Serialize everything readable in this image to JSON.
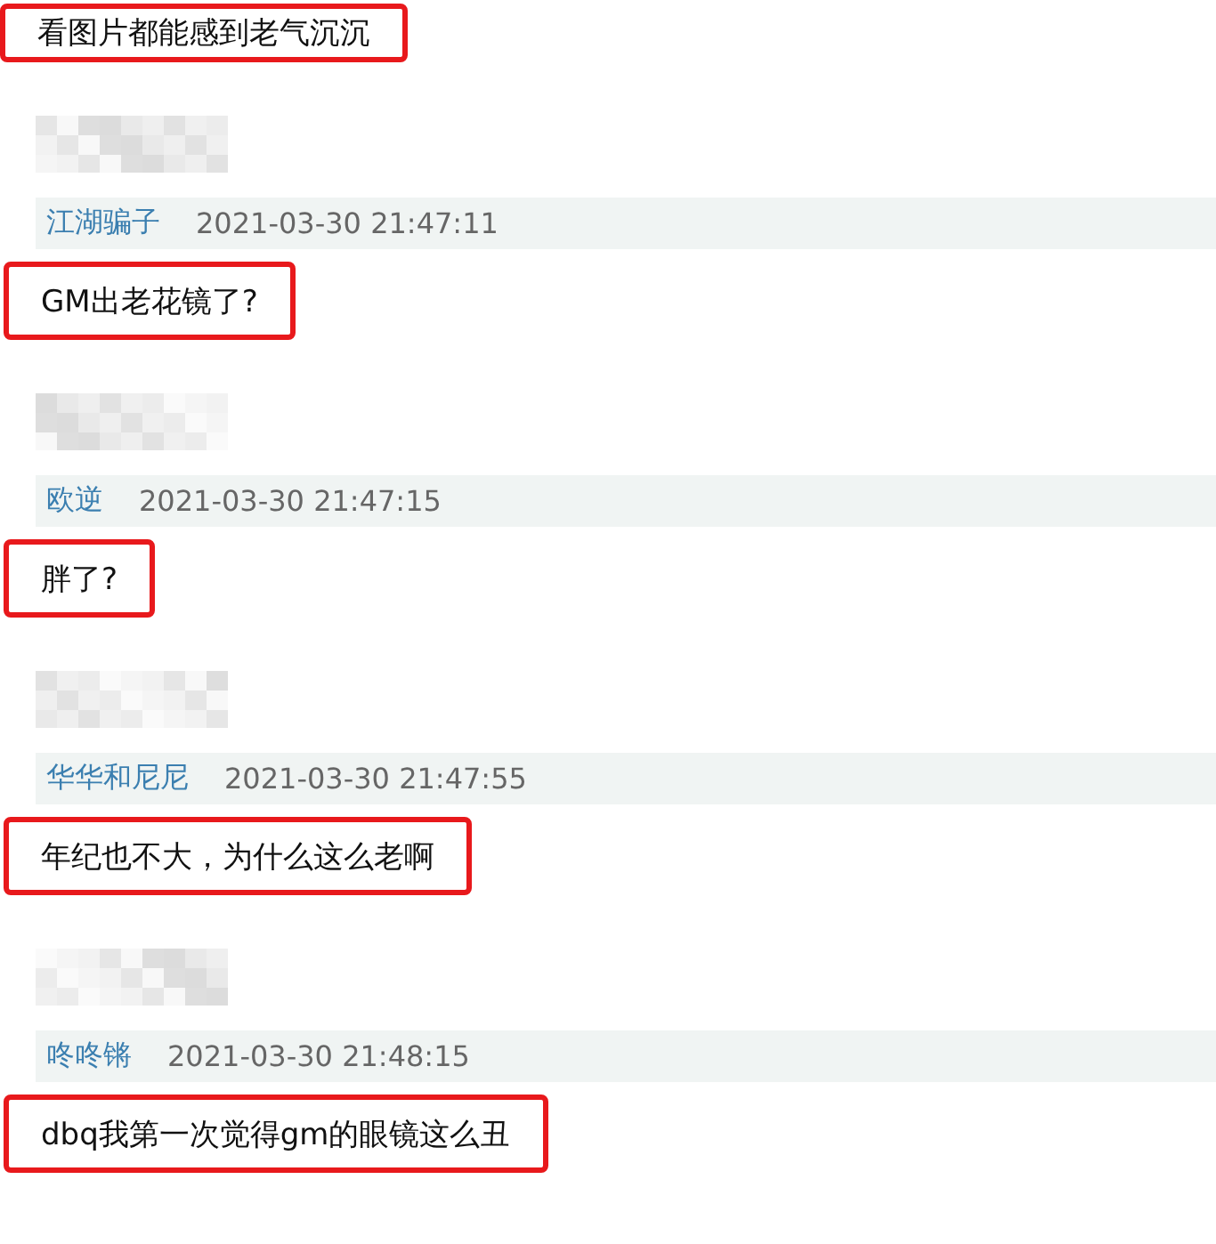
{
  "top_comment": {
    "text": "看图片都能感到老气沉沉"
  },
  "comments": [
    {
      "author": "江湖骗子",
      "time": "2021-03-30 21:47:11",
      "text": "GM出老花镜了?"
    },
    {
      "author": "欧逆",
      "time": "2021-03-30 21:47:15",
      "text": "胖了?"
    },
    {
      "author": "华华和尼尼",
      "time": "2021-03-30 21:47:55",
      "text": "年纪也不大，为什么这么老啊"
    },
    {
      "author": "咚咚锵",
      "time": "2021-03-30 21:48:15",
      "text": "dbq我第一次觉得gm的眼镜这么丑"
    }
  ]
}
